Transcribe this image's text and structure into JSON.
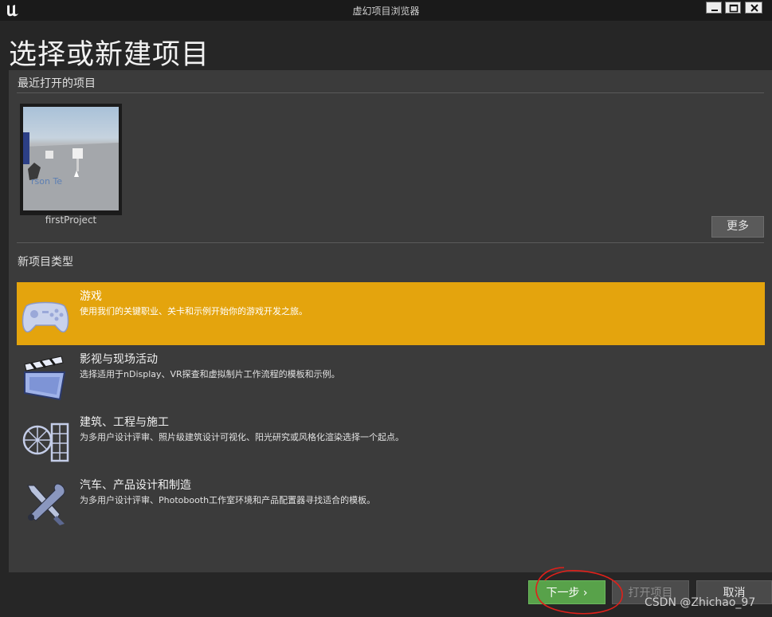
{
  "window": {
    "title": "虚幻项目浏览器"
  },
  "page": {
    "title": "选择或新建项目"
  },
  "recent": {
    "section_label": "最近打开的项目",
    "projects": [
      {
        "name": "firstProject"
      }
    ],
    "more_label": "更多"
  },
  "new_types": {
    "section_label": "新项目类型",
    "items": [
      {
        "name": "游戏",
        "desc": "使用我们的关键职业、关卡和示例开始你的游戏开发之旅。",
        "icon": "gamepad-icon",
        "selected": true
      },
      {
        "name": "影视与现场活动",
        "desc": "选择适用于nDisplay、VR探查和虚拟制片工作流程的模板和示例。",
        "icon": "clapperboard-icon",
        "selected": false
      },
      {
        "name": "建筑、工程与施工",
        "desc": "为多用户设计评审、照片级建筑设计可视化、阳光研究或风格化渲染选择一个起点。",
        "icon": "architecture-icon",
        "selected": false
      },
      {
        "name": "汽车、产品设计和制造",
        "desc": "为多用户设计评审、Photobooth工作室环境和产品配置器寻找适合的模板。",
        "icon": "tools-icon",
        "selected": false
      }
    ]
  },
  "footer": {
    "next_label": "下一步 ›",
    "open_label": "打开项目",
    "cancel_label": "取消",
    "watermark": "CSDN @Zhichao_97"
  },
  "colors": {
    "selected": "#e4a40d",
    "next_button": "#58a24a",
    "annotation": "#e0201a"
  }
}
